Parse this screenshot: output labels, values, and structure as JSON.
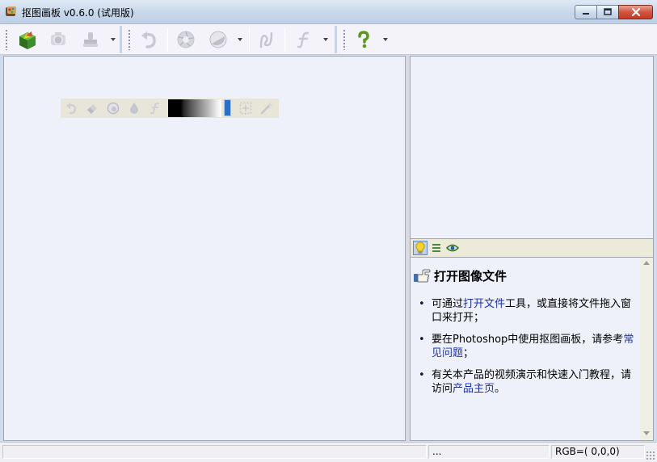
{
  "window": {
    "title": "抠图画板 v0.6.0 (试用版)",
    "icons": {
      "app": "app-paint-icon",
      "minimize": "minimize-icon",
      "maximize": "maximize-icon",
      "close": "close-icon"
    }
  },
  "toolbar": {
    "tools": [
      {
        "name": "open-file-tool",
        "icon": "green-cube-icon",
        "enabled": true
      },
      {
        "name": "camera-tool",
        "icon": "camera-icon",
        "enabled": false
      },
      {
        "name": "stamp-tool",
        "icon": "stamp-icon",
        "enabled": false,
        "dropdown": true
      },
      {
        "name": "undo-tool",
        "icon": "undo-arrow-icon",
        "enabled": false
      },
      {
        "name": "aperture-tool",
        "icon": "aperture-icon",
        "enabled": false
      },
      {
        "name": "contrast-tool",
        "icon": "contrast-circle-icon",
        "enabled": false,
        "dropdown": true
      },
      {
        "name": "curve-tool",
        "icon": "curve-icon",
        "enabled": false
      },
      {
        "name": "function-tool",
        "icon": "function-f-icon",
        "enabled": false,
        "dropdown": true
      },
      {
        "name": "help-tool",
        "icon": "help-question-icon",
        "enabled": true,
        "dropdown": true
      }
    ]
  },
  "float_toolbar": {
    "tools": [
      "undo-arrow-icon",
      "eraser-icon",
      "circle-brush-icon",
      "drop-icon",
      "function-f-icon"
    ],
    "selected_color": "#2c6fcb",
    "extra_tools": [
      "marquee-select-icon",
      "magic-wand-icon"
    ]
  },
  "side_tabs": [
    {
      "name": "tab-tips",
      "icon": "lightbulb-icon",
      "active": true
    },
    {
      "name": "tab-list",
      "icon": "list-icon",
      "active": false
    },
    {
      "name": "tab-preview",
      "icon": "eye-icon",
      "active": false
    }
  ],
  "help": {
    "title": "打开图像文件",
    "items": [
      {
        "pre": "可通过",
        "link": "打开文件",
        "post": "工具，或直接将文件拖入窗口来打开；"
      },
      {
        "pre": "要在Photoshop中使用抠图画板，请参考",
        "link": "常见问题",
        "post": "；"
      },
      {
        "pre": "有关本产品的视频演示和快速入门教程，请访问",
        "link": "产品主页",
        "post": "。"
      }
    ]
  },
  "status": {
    "left": "",
    "middle": "...",
    "rgb": "RGB=( 0,0,0)"
  },
  "colors": {
    "link": "#1b2fb0",
    "accent": "#2c6fcb",
    "panel_bg": "#eef0fa"
  }
}
